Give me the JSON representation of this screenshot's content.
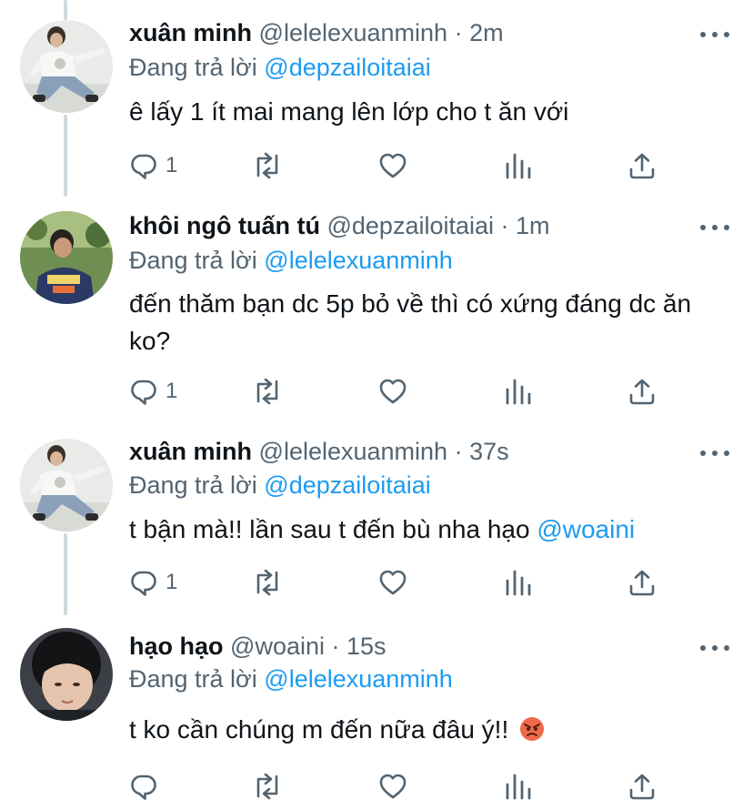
{
  "tweets": [
    {
      "name": "xuân minh",
      "handle": "@lelelexuanminh",
      "dot": "·",
      "time": "2m",
      "reply_prefix": "Đang trả lời",
      "reply_to": "@depzailoitaiai",
      "text": "ê lấy 1 ít mai mang lên lớp cho t ăn với",
      "reply_count": "1"
    },
    {
      "name": "khôi ngô tuấn tú",
      "handle": "@depzailoitaiai",
      "dot": "·",
      "time": "1m",
      "reply_prefix": "Đang trả lời",
      "reply_to": "@lelelexuanminh",
      "text": "đến thăm bạn dc 5p bỏ về thì có xứng đáng dc ăn ko?",
      "reply_count": "1"
    },
    {
      "name": "xuân minh",
      "handle": "@lelelexuanminh",
      "dot": "·",
      "time": "37s",
      "reply_prefix": "Đang trả lời",
      "reply_to": "@depzailoitaiai",
      "text": "t bận mà!! lần sau t đến bù nha hạo",
      "text_mention": "@woaini",
      "reply_count": "1"
    },
    {
      "name": "hạo hạo",
      "handle": "@woaini",
      "dot": "·",
      "time": "15s",
      "reply_prefix": "Đang trả lời",
      "reply_to": "@lelelexuanminh",
      "text": "t ko cần chúng m đến nữa đâu ý!!",
      "emoji": "angry-face-emoji",
      "reply_count": ""
    }
  ],
  "colors": {
    "text": "#0f1419",
    "secondary": "#536471",
    "accent": "#1d9bf0",
    "thread_line": "#cfd9de"
  },
  "icons": [
    "reply-icon",
    "retweet-icon",
    "like-icon",
    "analytics-icon",
    "share-icon",
    "more-icon"
  ]
}
